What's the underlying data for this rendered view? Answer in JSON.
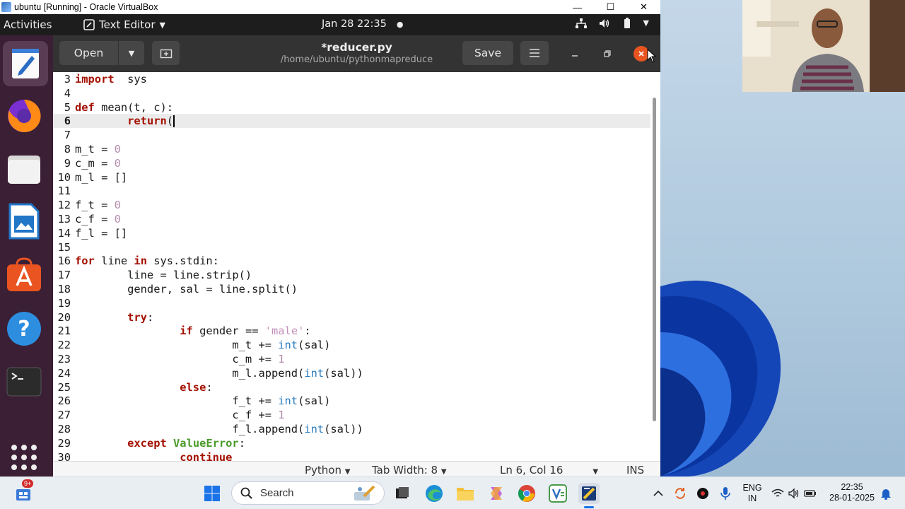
{
  "vbox": {
    "title": "ubuntu [Running] - Oracle VirtualBox",
    "min": "—",
    "max": "☐",
    "close": "✕"
  },
  "topbar": {
    "activities": "Activities",
    "app_name": "Text Editor",
    "clock": "Jan 28  22:35"
  },
  "editor": {
    "open_label": "Open",
    "save_label": "Save",
    "filename": "*reducer.py",
    "path": "/home/ubuntu/pythonmapreduce",
    "current_line": 6,
    "lines": [
      {
        "n": "3",
        "t": [
          [
            "kw",
            "import"
          ],
          [
            "",
            "  sys"
          ]
        ]
      },
      {
        "n": "4",
        "t": []
      },
      {
        "n": "5",
        "t": [
          [
            "kw",
            "def"
          ],
          [
            "",
            " mean(t, c):"
          ]
        ]
      },
      {
        "n": "6",
        "t": [
          [
            "",
            "        "
          ],
          [
            "kw",
            "return"
          ],
          [
            "",
            "("
          ]
        ],
        "caret": true
      },
      {
        "n": "7",
        "t": []
      },
      {
        "n": "8",
        "t": [
          [
            "",
            "m_t = "
          ],
          [
            "num",
            "0"
          ]
        ]
      },
      {
        "n": "9",
        "t": [
          [
            "",
            "c_m = "
          ],
          [
            "num",
            "0"
          ]
        ]
      },
      {
        "n": "10",
        "t": [
          [
            "",
            "m_l = []"
          ]
        ]
      },
      {
        "n": "11",
        "t": []
      },
      {
        "n": "12",
        "t": [
          [
            "",
            "f_t = "
          ],
          [
            "num",
            "0"
          ]
        ]
      },
      {
        "n": "13",
        "t": [
          [
            "",
            "c_f = "
          ],
          [
            "num",
            "0"
          ]
        ]
      },
      {
        "n": "14",
        "t": [
          [
            "",
            "f_l = []"
          ]
        ]
      },
      {
        "n": "15",
        "t": []
      },
      {
        "n": "16",
        "t": [
          [
            "kw",
            "for"
          ],
          [
            "",
            " line "
          ],
          [
            "kw",
            "in"
          ],
          [
            "",
            " sys.stdin:"
          ]
        ]
      },
      {
        "n": "17",
        "t": [
          [
            "",
            "        line = line.strip()"
          ]
        ]
      },
      {
        "n": "18",
        "t": [
          [
            "",
            "        gender, sal = line.split()"
          ]
        ]
      },
      {
        "n": "19",
        "t": []
      },
      {
        "n": "20",
        "t": [
          [
            "",
            "        "
          ],
          [
            "kw",
            "try"
          ],
          [
            "",
            ":"
          ]
        ]
      },
      {
        "n": "21",
        "t": [
          [
            "",
            "                "
          ],
          [
            "kw",
            "if"
          ],
          [
            "",
            " gender == "
          ],
          [
            "str",
            "'male'"
          ],
          [
            "",
            ":"
          ]
        ]
      },
      {
        "n": "22",
        "t": [
          [
            "",
            "                        m_t += "
          ],
          [
            "bi",
            "int"
          ],
          [
            "",
            "(sal)"
          ]
        ]
      },
      {
        "n": "23",
        "t": [
          [
            "",
            "                        c_m += "
          ],
          [
            "num",
            "1"
          ]
        ]
      },
      {
        "n": "24",
        "t": [
          [
            "",
            "                        m_l.append("
          ],
          [
            "bi",
            "int"
          ],
          [
            "",
            "(sal))"
          ]
        ]
      },
      {
        "n": "25",
        "t": [
          [
            "",
            "                "
          ],
          [
            "kw",
            "else"
          ],
          [
            "",
            ":"
          ]
        ]
      },
      {
        "n": "26",
        "t": [
          [
            "",
            "                        f_t += "
          ],
          [
            "bi",
            "int"
          ],
          [
            "",
            "(sal)"
          ]
        ]
      },
      {
        "n": "27",
        "t": [
          [
            "",
            "                        c_f += "
          ],
          [
            "num",
            "1"
          ]
        ]
      },
      {
        "n": "28",
        "t": [
          [
            "",
            "                        f_l.append("
          ],
          [
            "bi",
            "int"
          ],
          [
            "",
            "(sal))"
          ]
        ]
      },
      {
        "n": "29",
        "t": [
          [
            "",
            "        "
          ],
          [
            "kw",
            "except"
          ],
          [
            "",
            " "
          ],
          [
            "cls",
            "ValueError"
          ],
          [
            "",
            ":"
          ]
        ]
      },
      {
        "n": "30",
        "t": [
          [
            "",
            "                "
          ],
          [
            "kw",
            "continue"
          ]
        ]
      }
    ],
    "status": {
      "language": "Python",
      "tab_width": "Tab Width: 8",
      "position": "Ln 6, Col 16",
      "mode": "INS"
    }
  },
  "taskbar": {
    "search_placeholder": "Search",
    "badge": "9+",
    "lang_top": "ENG",
    "lang_bottom": "IN",
    "time": "22:35",
    "date": "28-01-2025"
  },
  "colors": {
    "ubuntu_orange": "#e95420",
    "dock": "#3a1f35",
    "keyword": "#a41000"
  }
}
